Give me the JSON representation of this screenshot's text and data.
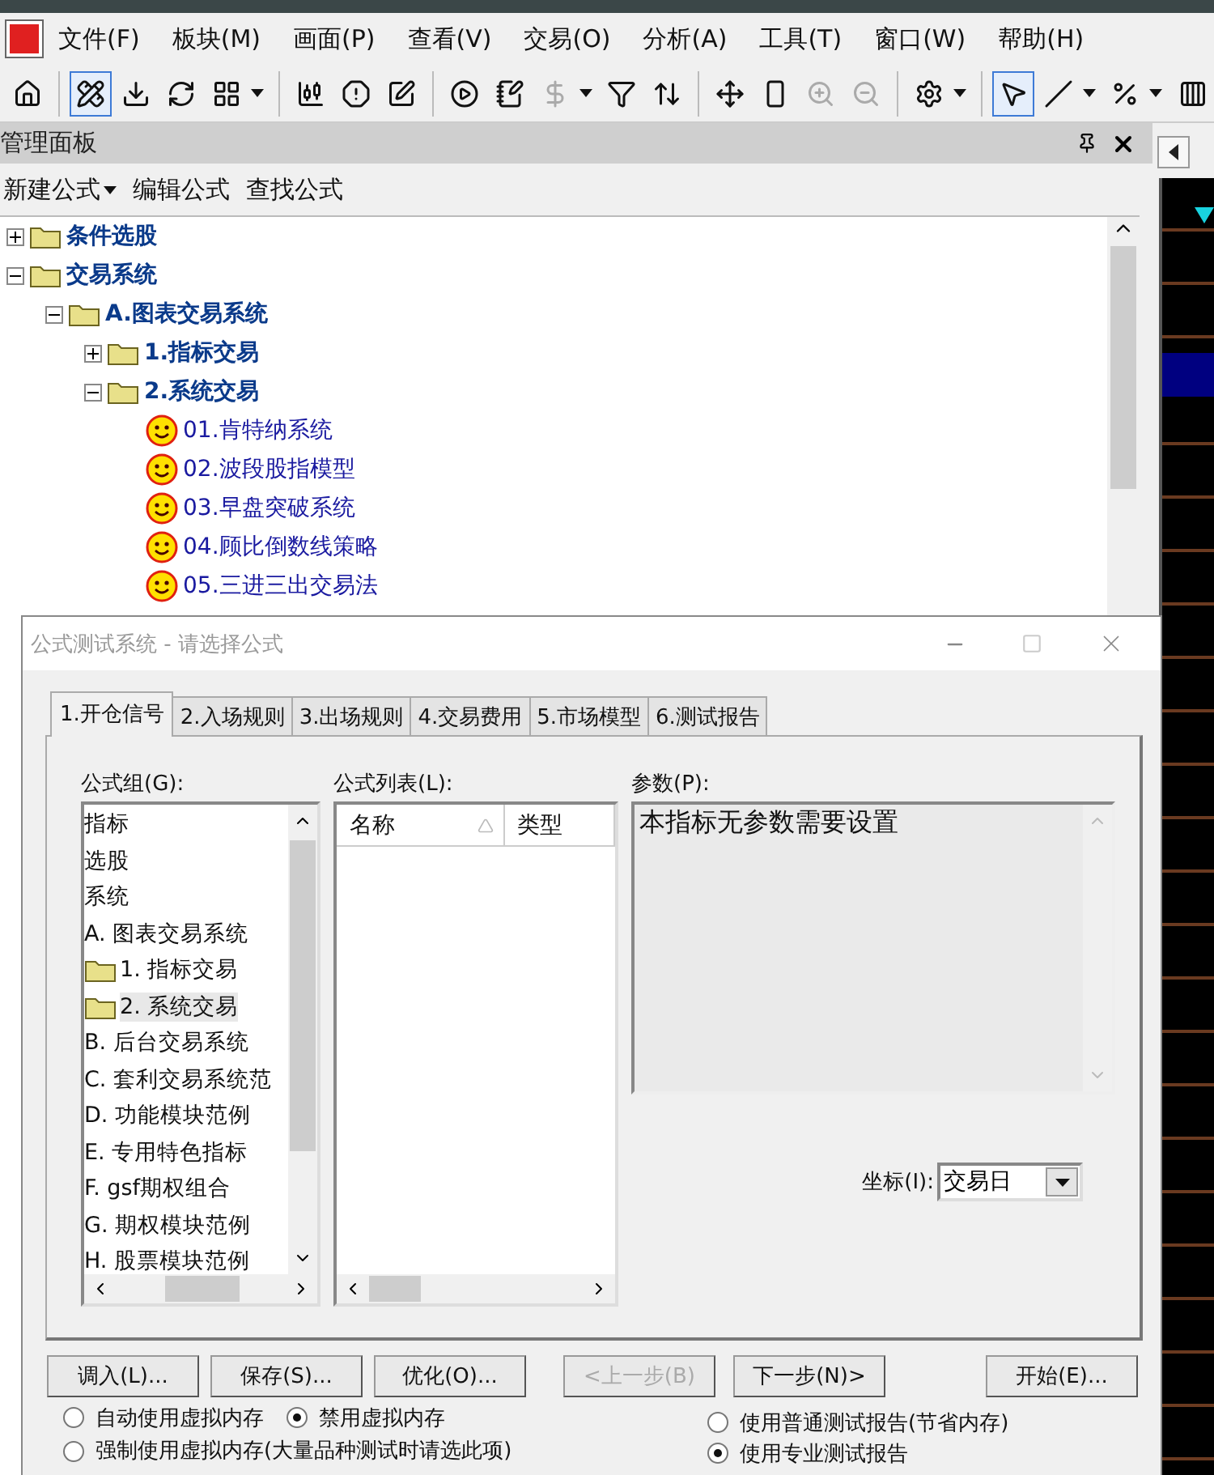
{
  "menu": [
    "文件(F)",
    "板块(M)",
    "画面(P)",
    "查看(V)",
    "交易(O)",
    "分析(A)",
    "工具(T)",
    "窗口(W)",
    "帮助(H)"
  ],
  "toolbar": [
    {
      "kind": "home",
      "selected": false,
      "disabled": false
    },
    {
      "kind": "sep"
    },
    {
      "kind": "ruler",
      "selected": true,
      "disabled": false
    },
    {
      "kind": "download",
      "selected": false,
      "disabled": false
    },
    {
      "kind": "refresh",
      "selected": false,
      "disabled": false
    },
    {
      "kind": "grid",
      "selected": false,
      "disabled": false
    },
    {
      "kind": "caret"
    },
    {
      "kind": "sep"
    },
    {
      "kind": "candles",
      "selected": false,
      "disabled": false
    },
    {
      "kind": "alert",
      "selected": false,
      "disabled": false
    },
    {
      "kind": "edit",
      "selected": false,
      "disabled": false
    },
    {
      "kind": "sep"
    },
    {
      "kind": "play",
      "selected": false,
      "disabled": false
    },
    {
      "kind": "note",
      "selected": false,
      "disabled": false
    },
    {
      "kind": "dollar",
      "selected": false,
      "disabled": true
    },
    {
      "kind": "caret"
    },
    {
      "kind": "filter",
      "selected": false,
      "disabled": false
    },
    {
      "kind": "sort",
      "selected": false,
      "disabled": false
    },
    {
      "kind": "sep"
    },
    {
      "kind": "move",
      "selected": false,
      "disabled": false
    },
    {
      "kind": "bar",
      "selected": false,
      "disabled": false
    },
    {
      "kind": "zoomin",
      "selected": false,
      "disabled": true
    },
    {
      "kind": "zoomout",
      "selected": false,
      "disabled": true
    },
    {
      "kind": "sep"
    },
    {
      "kind": "settings",
      "selected": false,
      "disabled": false
    },
    {
      "kind": "caret"
    },
    {
      "kind": "sep"
    },
    {
      "kind": "cursor",
      "selected": true,
      "disabled": false
    },
    {
      "kind": "line",
      "selected": false,
      "disabled": false
    },
    {
      "kind": "caret"
    },
    {
      "kind": "percent",
      "selected": false,
      "disabled": false
    },
    {
      "kind": "caret"
    },
    {
      "kind": "columns",
      "selected": false,
      "disabled": false
    }
  ],
  "panel": {
    "title": "管理面板",
    "actions": [
      {
        "label": "新建公式",
        "dropdown": true
      },
      {
        "label": "编辑公式",
        "dropdown": false
      },
      {
        "label": "查找公式",
        "dropdown": false
      }
    ],
    "tree": [
      {
        "label": "条件选股",
        "kind": "folder",
        "expanded": false
      },
      {
        "label": "交易系统",
        "kind": "folder",
        "expanded": true,
        "children": [
          {
            "label": "A.图表交易系统",
            "kind": "folder",
            "expanded": true,
            "children": [
              {
                "label": "1.指标交易",
                "kind": "folder",
                "expanded": false
              },
              {
                "label": "2.系统交易",
                "kind": "folder",
                "expanded": true,
                "children": [
                  {
                    "label": "01.肯特纳系统",
                    "kind": "formula"
                  },
                  {
                    "label": "02.波段股指模型",
                    "kind": "formula"
                  },
                  {
                    "label": "03.早盘突破系统",
                    "kind": "formula"
                  },
                  {
                    "label": "04.顾比倒数线策略",
                    "kind": "formula"
                  },
                  {
                    "label": "05.三进三出交易法",
                    "kind": "formula"
                  }
                ]
              }
            ]
          }
        ]
      }
    ]
  },
  "dialog": {
    "title": "公式测试系统 - 请选择公式",
    "tabs": [
      {
        "label": "1.开仓信号",
        "selected": true
      },
      {
        "label": "2.入场规则",
        "selected": false
      },
      {
        "label": "3.出场规则",
        "selected": false
      },
      {
        "label": "4.交易费用",
        "selected": false
      },
      {
        "label": "5.市场模型",
        "selected": false
      },
      {
        "label": "6.测试报告",
        "selected": false
      }
    ],
    "group_label": "公式组(G):",
    "groups": [
      {
        "label": "指标",
        "kind": "text",
        "selected": false
      },
      {
        "label": "选股",
        "kind": "text",
        "selected": false
      },
      {
        "label": "系统",
        "kind": "text",
        "selected": false
      },
      {
        "label": "A. 图表交易系统",
        "kind": "text",
        "selected": false
      },
      {
        "label": "1. 指标交易",
        "kind": "folder",
        "selected": false
      },
      {
        "label": "2. 系统交易",
        "kind": "folder",
        "selected": true
      },
      {
        "label": "B. 后台交易系统",
        "kind": "text",
        "selected": false
      },
      {
        "label": "C. 套利交易系统范",
        "kind": "text",
        "selected": false
      },
      {
        "label": "D. 功能模块范例",
        "kind": "text",
        "selected": false
      },
      {
        "label": "E. 专用特色指标",
        "kind": "text",
        "selected": false
      },
      {
        "label": "F. gsf期权组合",
        "kind": "text",
        "selected": false
      },
      {
        "label": "G. 期权模块范例",
        "kind": "text",
        "selected": false
      },
      {
        "label": "H. 股票模块范例",
        "kind": "text",
        "selected": false
      }
    ],
    "list_label": "公式列表(L):",
    "columns": [
      "名称",
      "类型"
    ],
    "params_label": "参数(P):",
    "params_text": "本指标无参数需要设置",
    "axis_label": "坐标(I):",
    "axis_value": "交易日",
    "buttons": [
      {
        "label": "调入(L)...",
        "disabled": false
      },
      {
        "label": "保存(S)...",
        "disabled": false
      },
      {
        "label": "优化(O)...",
        "disabled": false
      },
      {
        "label": "<上一步(B)",
        "disabled": true
      },
      {
        "label": "下一步(N)>",
        "disabled": false
      },
      {
        "label": "开始(E)...",
        "disabled": false
      }
    ],
    "memory_options": [
      {
        "label": "自动使用虚拟内存",
        "selected": false
      },
      {
        "label": "禁用虚拟内存",
        "selected": true
      },
      {
        "label": "强制使用虚拟内存(大量品种测试时请选此项)",
        "selected": false
      }
    ],
    "report_options": [
      {
        "label": "使用普通测试报告(节省内存)",
        "selected": false
      },
      {
        "label": "使用专业测试报告",
        "selected": true
      }
    ]
  }
}
